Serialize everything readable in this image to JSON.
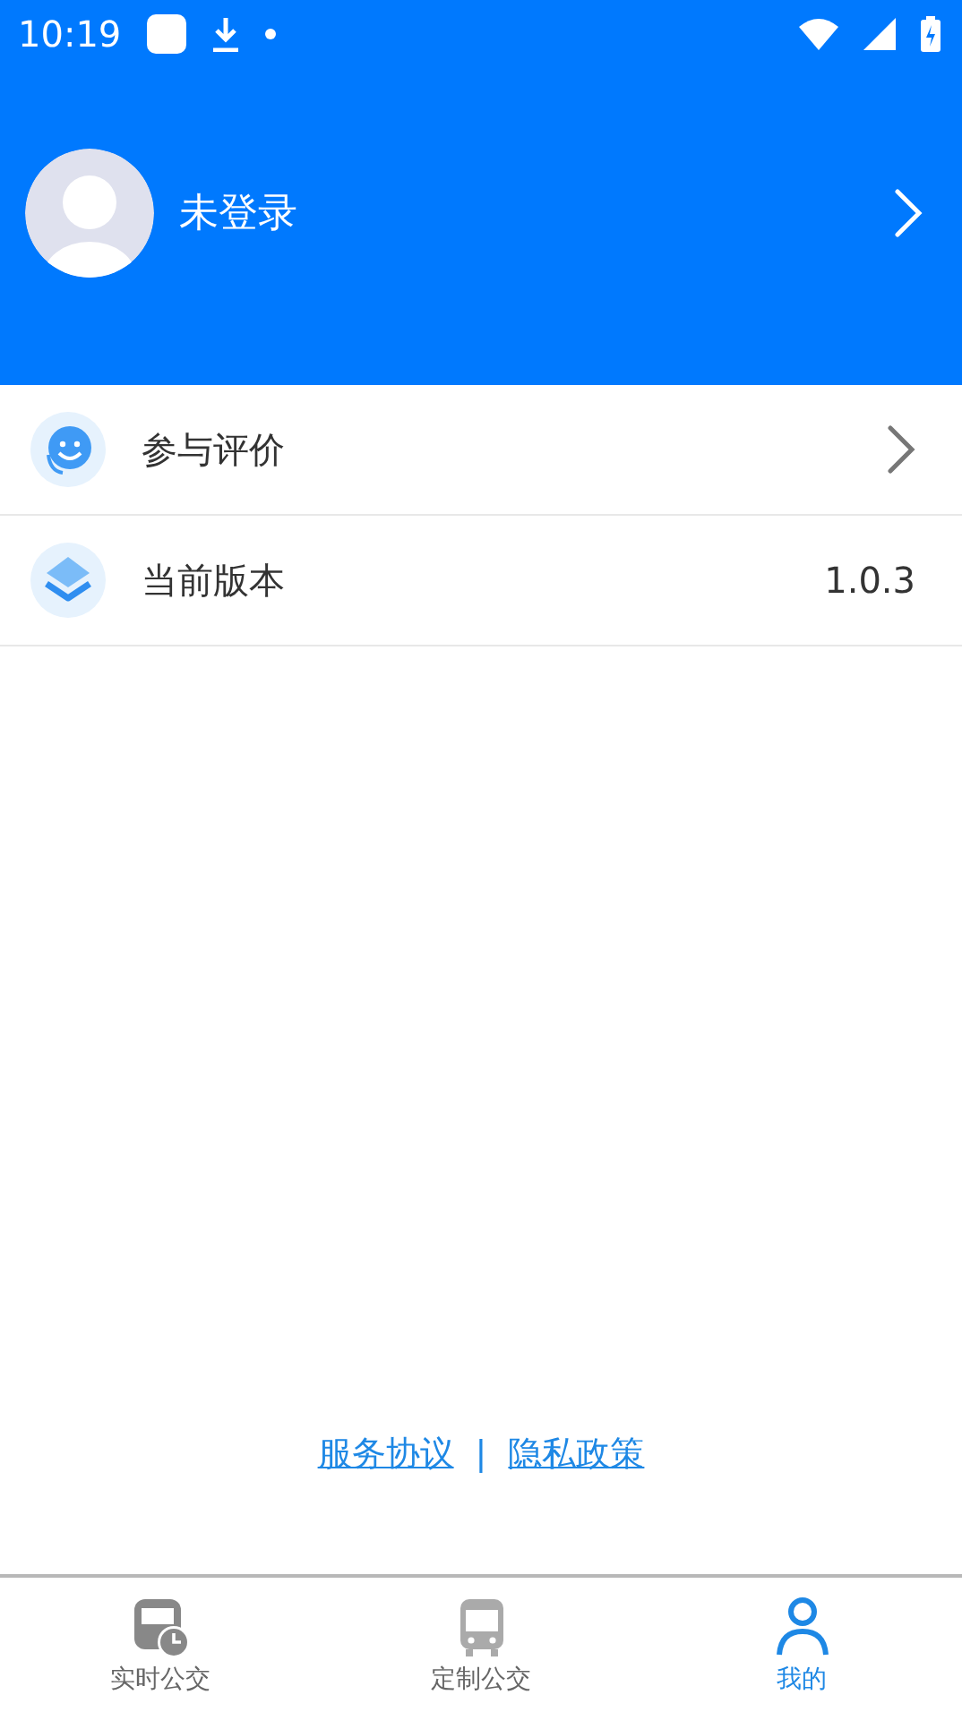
{
  "status_bar": {
    "time": "10:19"
  },
  "profile": {
    "name": "未登录"
  },
  "menu": [
    {
      "kind": "link",
      "label": "参与评价"
    },
    {
      "kind": "value",
      "label": "当前版本",
      "value": "1.0.3"
    }
  ],
  "footer_links": [
    "服务协议",
    "隐私政策"
  ],
  "footer_separator": "|",
  "tabs": [
    {
      "label": "实时公交",
      "selected": false
    },
    {
      "label": "定制公交",
      "selected": false
    },
    {
      "label": "我的",
      "selected": true
    }
  ]
}
